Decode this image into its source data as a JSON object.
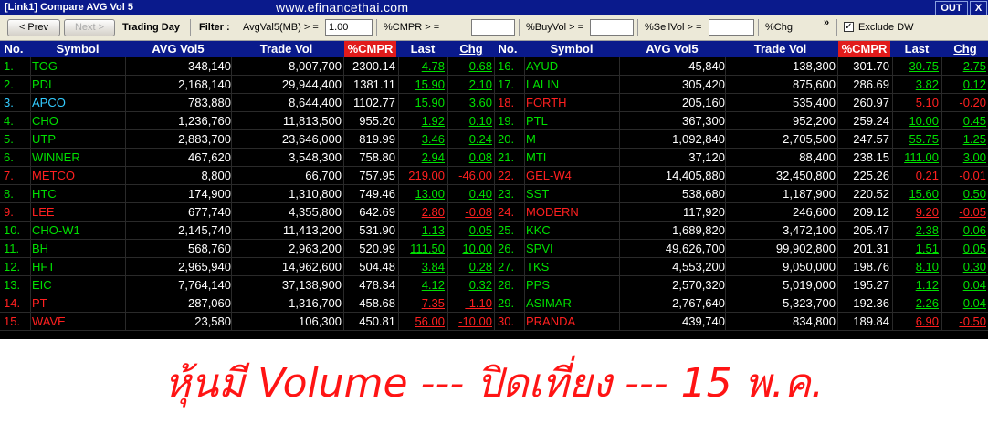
{
  "window": {
    "title": "[Link1] Compare AVG Vol 5",
    "watermark": "www.efinancethai.com",
    "out_label": "OUT",
    "close_label": "X"
  },
  "toolbar": {
    "prev_label": "< Prev",
    "next_label": "Next >",
    "trading_day": "Trading Day",
    "filter_label": "Filter :",
    "avgvol_label": "AvgVal5(MB) > =",
    "avgvol_value": "1.00",
    "cmpr_label": "%CMPR > =",
    "cmpr_value": "",
    "buyvol_label": "%BuyVol > =",
    "buyvol_value": "",
    "sellvol_label": "%SellVol > =",
    "sellvol_value": "",
    "chg_label": "%Chg",
    "more_label": "»",
    "exclude_label": "Exclude DW",
    "exclude_checked": "✓"
  },
  "columns": [
    "No.",
    "Symbol",
    "AVG Vol5",
    "Trade Vol",
    "%CMPR",
    "Last",
    "Chg"
  ],
  "colors": {
    "green": "#00e000",
    "red": "#ff2020",
    "cyan": "#33ccff",
    "white": "#ffffff",
    "header": "#0a1a8c",
    "cmpr_header": "#e11b1b"
  },
  "rows_left": [
    {
      "no": "1.",
      "symbol": "TOG",
      "avg": "348,140",
      "trade": "8,007,700",
      "cmpr": "2300.14",
      "last": "4.78",
      "chg": "0.68",
      "color": "green"
    },
    {
      "no": "2.",
      "symbol": "PDI",
      "avg": "2,168,140",
      "trade": "29,944,400",
      "cmpr": "1381.11",
      "last": "15.90",
      "chg": "2.10",
      "color": "green"
    },
    {
      "no": "3.",
      "symbol": "APCO",
      "avg": "783,880",
      "trade": "8,644,400",
      "cmpr": "1102.77",
      "last": "15.90",
      "chg": "3.60",
      "color": "cyan"
    },
    {
      "no": "4.",
      "symbol": "CHO",
      "avg": "1,236,760",
      "trade": "11,813,500",
      "cmpr": "955.20",
      "last": "1.92",
      "chg": "0.10",
      "color": "green"
    },
    {
      "no": "5.",
      "symbol": "UTP",
      "avg": "2,883,700",
      "trade": "23,646,000",
      "cmpr": "819.99",
      "last": "3.46",
      "chg": "0.24",
      "color": "green"
    },
    {
      "no": "6.",
      "symbol": "WINNER",
      "avg": "467,620",
      "trade": "3,548,300",
      "cmpr": "758.80",
      "last": "2.94",
      "chg": "0.08",
      "color": "green"
    },
    {
      "no": "7.",
      "symbol": "METCO",
      "avg": "8,800",
      "trade": "66,700",
      "cmpr": "757.95",
      "last": "219.00",
      "chg": "-46.00",
      "color": "red"
    },
    {
      "no": "8.",
      "symbol": "HTC",
      "avg": "174,900",
      "trade": "1,310,800",
      "cmpr": "749.46",
      "last": "13.00",
      "chg": "0.40",
      "color": "green"
    },
    {
      "no": "9.",
      "symbol": "LEE",
      "avg": "677,740",
      "trade": "4,355,800",
      "cmpr": "642.69",
      "last": "2.80",
      "chg": "-0.08",
      "color": "red"
    },
    {
      "no": "10.",
      "symbol": "CHO-W1",
      "avg": "2,145,740",
      "trade": "11,413,200",
      "cmpr": "531.90",
      "last": "1.13",
      "chg": "0.05",
      "color": "green"
    },
    {
      "no": "11.",
      "symbol": "BH",
      "avg": "568,760",
      "trade": "2,963,200",
      "cmpr": "520.99",
      "last": "111.50",
      "chg": "10.00",
      "color": "green"
    },
    {
      "no": "12.",
      "symbol": "HFT",
      "avg": "2,965,940",
      "trade": "14,962,600",
      "cmpr": "504.48",
      "last": "3.84",
      "chg": "0.28",
      "color": "green"
    },
    {
      "no": "13.",
      "symbol": "EIC",
      "avg": "7,764,140",
      "trade": "37,138,900",
      "cmpr": "478.34",
      "last": "4.12",
      "chg": "0.32",
      "color": "green"
    },
    {
      "no": "14.",
      "symbol": "PT",
      "avg": "287,060",
      "trade": "1,316,700",
      "cmpr": "458.68",
      "last": "7.35",
      "chg": "-1.10",
      "color": "red"
    },
    {
      "no": "15.",
      "symbol": "WAVE",
      "avg": "23,580",
      "trade": "106,300",
      "cmpr": "450.81",
      "last": "56.00",
      "chg": "-10.00",
      "color": "red"
    }
  ],
  "rows_right": [
    {
      "no": "16.",
      "symbol": "AYUD",
      "avg": "45,840",
      "trade": "138,300",
      "cmpr": "301.70",
      "last": "30.75",
      "chg": "2.75",
      "color": "green"
    },
    {
      "no": "17.",
      "symbol": "LALIN",
      "avg": "305,420",
      "trade": "875,600",
      "cmpr": "286.69",
      "last": "3.82",
      "chg": "0.12",
      "color": "green"
    },
    {
      "no": "18.",
      "symbol": "FORTH",
      "avg": "205,160",
      "trade": "535,400",
      "cmpr": "260.97",
      "last": "5.10",
      "chg": "-0.20",
      "color": "red"
    },
    {
      "no": "19.",
      "symbol": "PTL",
      "avg": "367,300",
      "trade": "952,200",
      "cmpr": "259.24",
      "last": "10.00",
      "chg": "0.45",
      "color": "green"
    },
    {
      "no": "20.",
      "symbol": "M",
      "avg": "1,092,840",
      "trade": "2,705,500",
      "cmpr": "247.57",
      "last": "55.75",
      "chg": "1.25",
      "color": "green"
    },
    {
      "no": "21.",
      "symbol": "MTI",
      "avg": "37,120",
      "trade": "88,400",
      "cmpr": "238.15",
      "last": "111.00",
      "chg": "3.00",
      "color": "green"
    },
    {
      "no": "22.",
      "symbol": "GEL-W4",
      "avg": "14,405,880",
      "trade": "32,450,800",
      "cmpr": "225.26",
      "last": "0.21",
      "chg": "-0.01",
      "color": "red"
    },
    {
      "no": "23.",
      "symbol": "SST",
      "avg": "538,680",
      "trade": "1,187,900",
      "cmpr": "220.52",
      "last": "15.60",
      "chg": "0.50",
      "color": "green"
    },
    {
      "no": "24.",
      "symbol": "MODERN",
      "avg": "117,920",
      "trade": "246,600",
      "cmpr": "209.12",
      "last": "9.20",
      "chg": "-0.05",
      "color": "red"
    },
    {
      "no": "25.",
      "symbol": "KKC",
      "avg": "1,689,820",
      "trade": "3,472,100",
      "cmpr": "205.47",
      "last": "2.38",
      "chg": "0.06",
      "color": "green"
    },
    {
      "no": "26.",
      "symbol": "SPVI",
      "avg": "49,626,700",
      "trade": "99,902,800",
      "cmpr": "201.31",
      "last": "1.51",
      "chg": "0.05",
      "color": "green"
    },
    {
      "no": "27.",
      "symbol": "TKS",
      "avg": "4,553,200",
      "trade": "9,050,000",
      "cmpr": "198.76",
      "last": "8.10",
      "chg": "0.30",
      "color": "green"
    },
    {
      "no": "28.",
      "symbol": "PPS",
      "avg": "2,570,320",
      "trade": "5,019,000",
      "cmpr": "195.27",
      "last": "1.12",
      "chg": "0.04",
      "color": "green"
    },
    {
      "no": "29.",
      "symbol": "ASIMAR",
      "avg": "2,767,640",
      "trade": "5,323,700",
      "cmpr": "192.36",
      "last": "2.26",
      "chg": "0.04",
      "color": "green"
    },
    {
      "no": "30.",
      "symbol": "PRANDA",
      "avg": "439,740",
      "trade": "834,800",
      "cmpr": "189.84",
      "last": "6.90",
      "chg": "-0.50",
      "color": "red"
    }
  ],
  "caption": "หุ้นมี Volume --- ปิดเที่ยง --- 15 พ.ค."
}
